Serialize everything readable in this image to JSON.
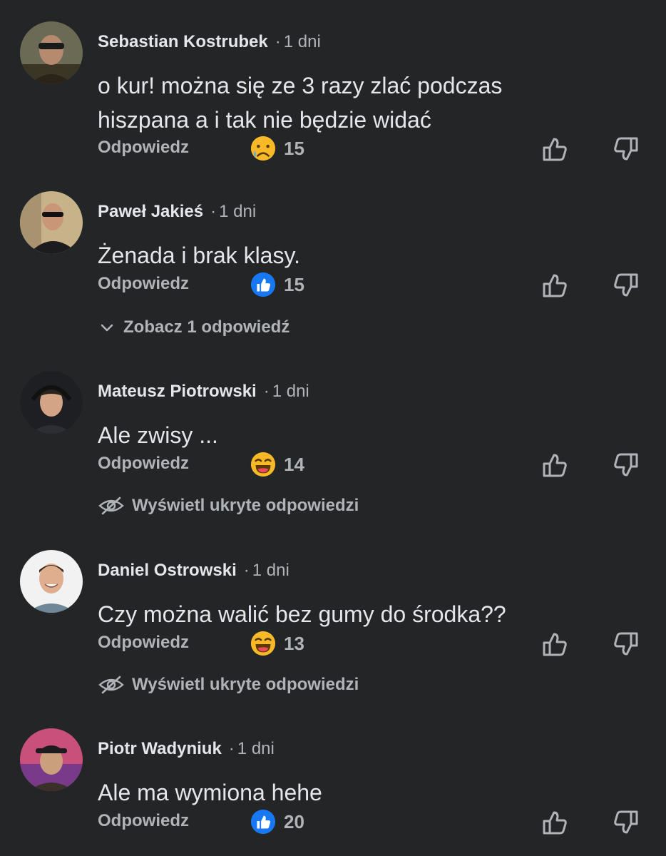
{
  "comments": [
    {
      "author": "Sebastian Kostrubek",
      "separator": "·",
      "time": "1 dni",
      "text_lines": [
        "o kur! można się ze 3 razy zlać podczas",
        "hiszpana a i tak nie będzie widać"
      ],
      "reply_label": "Odpowiedz",
      "reaction_icon": "sad-tear-emoji-icon",
      "reaction_count": "15"
    },
    {
      "author": "Paweł Jakieś",
      "separator": "·",
      "time": "1 dni",
      "text_lines": [
        "Żenada i brak klasy."
      ],
      "reply_label": "Odpowiedz",
      "reaction_icon": "like-reaction-icon",
      "reaction_count": "15",
      "more_label": "Zobacz 1 odpowiedź",
      "more_icon": "chevron-down-icon"
    },
    {
      "author": "Mateusz Piotrowski",
      "separator": "·",
      "time": "1 dni",
      "text_lines": [
        "Ale zwisy ..."
      ],
      "reply_label": "Odpowiedz",
      "reaction_icon": "laughing-emoji-icon",
      "reaction_count": "14",
      "more_label": "Wyświetl ukryte odpowiedzi",
      "more_icon": "hidden-eye-icon"
    },
    {
      "author": "Daniel Ostrowski",
      "separator": "·",
      "time": "1 dni",
      "text_lines": [
        "Czy można walić bez gumy do środka??"
      ],
      "reply_label": "Odpowiedz",
      "reaction_icon": "laughing-emoji-icon",
      "reaction_count": "13",
      "more_label": "Wyświetl ukryte odpowiedzi",
      "more_icon": "hidden-eye-icon"
    },
    {
      "author": "Piotr Wadyniuk",
      "separator": "·",
      "time": "1 dni",
      "text_lines": [
        "Ale ma wymiona hehe"
      ],
      "reply_label": "Odpowiedz",
      "reaction_icon": "like-reaction-icon",
      "reaction_count": "20"
    }
  ],
  "colors": {
    "background": "#242526",
    "text_primary": "#e4e6eb",
    "text_secondary": "#b0b3b8",
    "like_blue": "#1877f2",
    "emoji_yellow": "#f7b928"
  }
}
